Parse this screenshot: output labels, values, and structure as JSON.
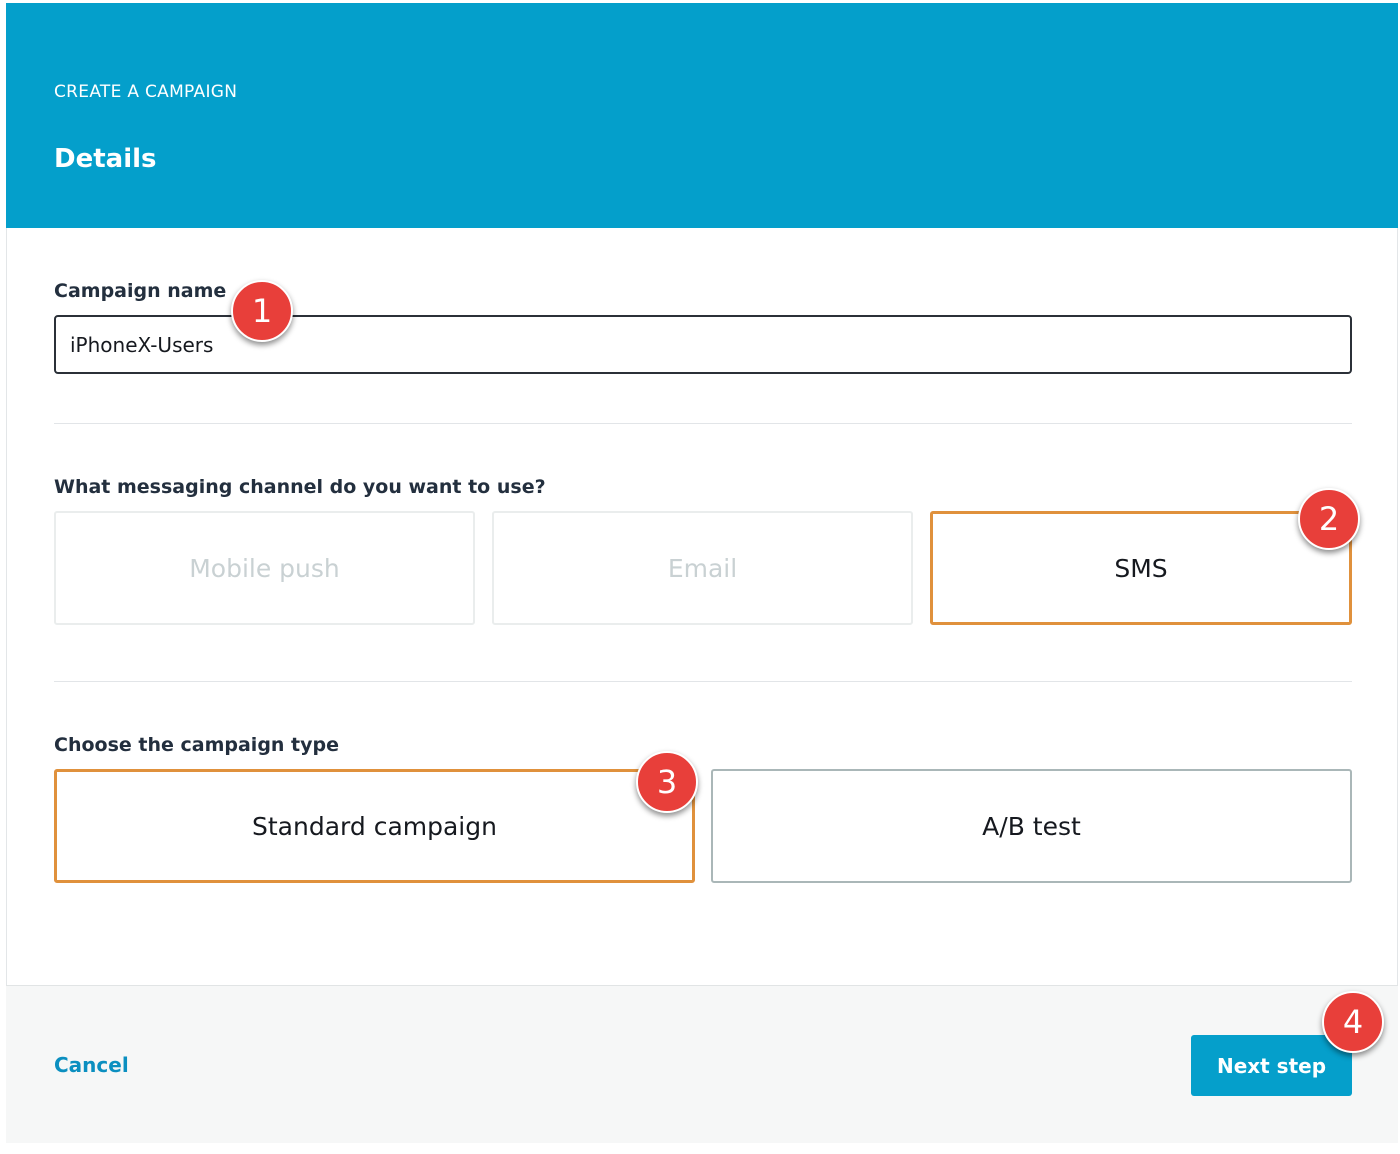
{
  "header": {
    "eyebrow": "CREATE A CAMPAIGN",
    "title": "Details"
  },
  "campaign_name": {
    "label": "Campaign name",
    "value": "iPhoneX-Users"
  },
  "channel": {
    "label": "What messaging channel do you want to use?",
    "options": [
      {
        "label": "Mobile push",
        "state": "disabled"
      },
      {
        "label": "Email",
        "state": "disabled"
      },
      {
        "label": "SMS",
        "state": "selected"
      }
    ]
  },
  "campaign_type": {
    "label": "Choose the campaign type",
    "options": [
      {
        "label": "Standard campaign",
        "state": "selected"
      },
      {
        "label": "A/B test",
        "state": "unselected"
      }
    ]
  },
  "footer": {
    "cancel_label": "Cancel",
    "next_label": "Next step"
  },
  "annotations": [
    "1",
    "2",
    "3",
    "4"
  ],
  "colors": {
    "header_bg": "#049fcb",
    "selected_border": "#e0913c",
    "primary_button": "#059fcb",
    "link": "#0b8fc0",
    "badge": "#e83f3a"
  }
}
